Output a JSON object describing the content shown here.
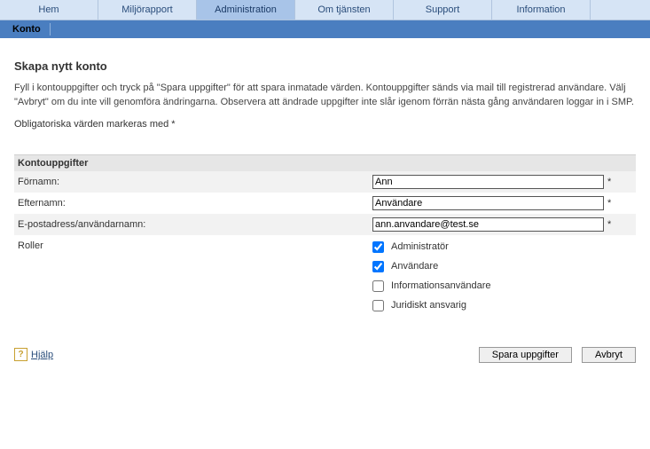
{
  "nav": {
    "tabs": [
      "Hem",
      "Miljörapport",
      "Administration",
      "Om tjänsten",
      "Support",
      "Information"
    ],
    "active_index": 2
  },
  "subnav": {
    "active": "Konto"
  },
  "page": {
    "title": "Skapa nytt konto",
    "intro": "Fyll i kontouppgifter och tryck på \"Spara uppgifter\" för att spara inmatade värden. Kontouppgifter sänds via mail till registrerad användare. Välj \"Avbryt\" om du inte vill genomföra ändringarna. Observera att ändrade uppgifter inte slår igenom förrän nästa gång användaren loggar in i SMP.",
    "mandatory_note": "Obligatoriska värden markeras med *"
  },
  "section": {
    "heading": "Kontouppgifter"
  },
  "form": {
    "firstname_label": "Förnamn:",
    "firstname_value": "Ann",
    "lastname_label": "Efternamn:",
    "lastname_value": "Användare",
    "email_label": "E-postadress/användarnamn:",
    "email_value": "ann.anvandare@test.se",
    "roles_label": "Roller",
    "required_marker": "*",
    "roles": [
      {
        "label": "Administratör",
        "checked": true
      },
      {
        "label": "Användare",
        "checked": true
      },
      {
        "label": "Informationsanvändare",
        "checked": false
      },
      {
        "label": "Juridiskt ansvarig",
        "checked": false
      }
    ]
  },
  "footer": {
    "help_label": "Hjälp",
    "help_icon": "?",
    "save_label": "Spara uppgifter",
    "cancel_label": "Avbryt"
  }
}
